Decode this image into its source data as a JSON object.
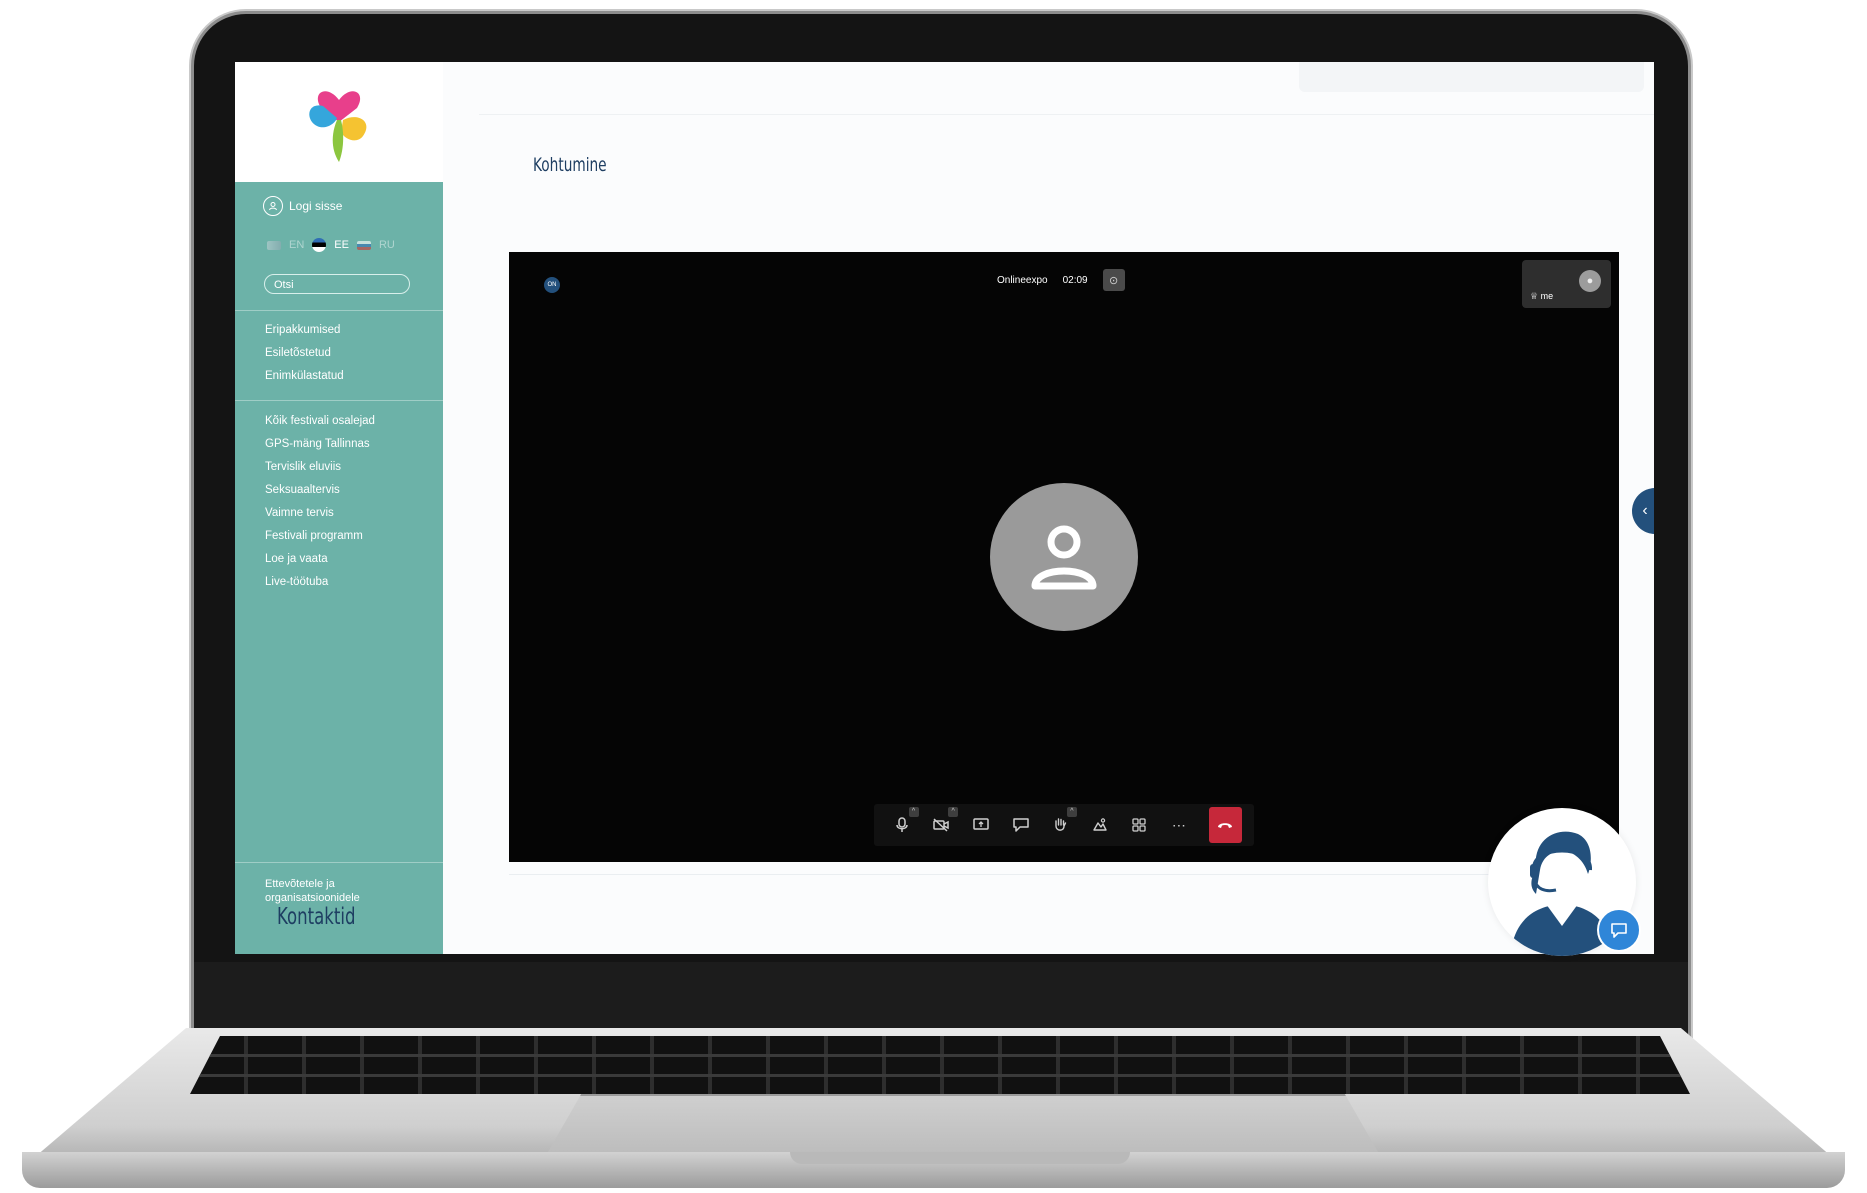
{
  "sidebar": {
    "login_label": "Logi sisse",
    "languages": [
      {
        "code": "EN",
        "active": false
      },
      {
        "code": "EE",
        "active": true
      },
      {
        "code": "RU",
        "active": false
      }
    ],
    "search_placeholder": "Otsi",
    "nav_group_1": [
      "Eripakkumised",
      "Esiletõstetud",
      "Enimkülastatud"
    ],
    "nav_group_2": [
      "Kõik festivali osalejad",
      "GPS-mäng Tallinnas",
      "Tervislik eluviis",
      "Seksuaaltervis",
      "Vaimne tervis",
      "Festivali programm",
      "Loe ja vaata",
      "Live-töötuba"
    ],
    "footer_link": "Ettevõtetele ja organisatsioonidele"
  },
  "main": {
    "meeting_title": "Kohtumine",
    "contacts_title": "Kontaktid"
  },
  "video": {
    "badge": "ON",
    "meeting_name": "Onlineexpo",
    "timer": "02:09",
    "self_label": "me",
    "toolbar": [
      "microphone",
      "camera-off",
      "screen-share",
      "chat",
      "raise-hand",
      "background",
      "tile-view",
      "more",
      "hang-up"
    ]
  },
  "colors": {
    "sidebar": "#6cb2a8",
    "accent": "#23507c",
    "hangup": "#c6283a",
    "chat": "#2f86d8"
  }
}
